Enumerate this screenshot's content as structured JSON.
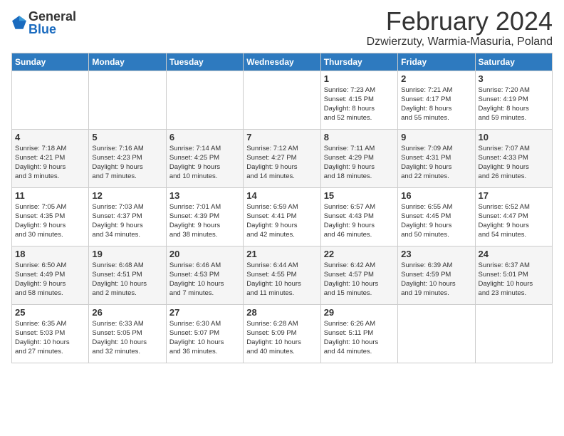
{
  "logo": {
    "general": "General",
    "blue": "Blue"
  },
  "title": "February 2024",
  "subtitle": "Dzwierzuty, Warmia-Masuria, Poland",
  "days_of_week": [
    "Sunday",
    "Monday",
    "Tuesday",
    "Wednesday",
    "Thursday",
    "Friday",
    "Saturday"
  ],
  "weeks": [
    [
      {
        "day": "",
        "info": ""
      },
      {
        "day": "",
        "info": ""
      },
      {
        "day": "",
        "info": ""
      },
      {
        "day": "",
        "info": ""
      },
      {
        "day": "1",
        "info": "Sunrise: 7:23 AM\nSunset: 4:15 PM\nDaylight: 8 hours\nand 52 minutes."
      },
      {
        "day": "2",
        "info": "Sunrise: 7:21 AM\nSunset: 4:17 PM\nDaylight: 8 hours\nand 55 minutes."
      },
      {
        "day": "3",
        "info": "Sunrise: 7:20 AM\nSunset: 4:19 PM\nDaylight: 8 hours\nand 59 minutes."
      }
    ],
    [
      {
        "day": "4",
        "info": "Sunrise: 7:18 AM\nSunset: 4:21 PM\nDaylight: 9 hours\nand 3 minutes."
      },
      {
        "day": "5",
        "info": "Sunrise: 7:16 AM\nSunset: 4:23 PM\nDaylight: 9 hours\nand 7 minutes."
      },
      {
        "day": "6",
        "info": "Sunrise: 7:14 AM\nSunset: 4:25 PM\nDaylight: 9 hours\nand 10 minutes."
      },
      {
        "day": "7",
        "info": "Sunrise: 7:12 AM\nSunset: 4:27 PM\nDaylight: 9 hours\nand 14 minutes."
      },
      {
        "day": "8",
        "info": "Sunrise: 7:11 AM\nSunset: 4:29 PM\nDaylight: 9 hours\nand 18 minutes."
      },
      {
        "day": "9",
        "info": "Sunrise: 7:09 AM\nSunset: 4:31 PM\nDaylight: 9 hours\nand 22 minutes."
      },
      {
        "day": "10",
        "info": "Sunrise: 7:07 AM\nSunset: 4:33 PM\nDaylight: 9 hours\nand 26 minutes."
      }
    ],
    [
      {
        "day": "11",
        "info": "Sunrise: 7:05 AM\nSunset: 4:35 PM\nDaylight: 9 hours\nand 30 minutes."
      },
      {
        "day": "12",
        "info": "Sunrise: 7:03 AM\nSunset: 4:37 PM\nDaylight: 9 hours\nand 34 minutes."
      },
      {
        "day": "13",
        "info": "Sunrise: 7:01 AM\nSunset: 4:39 PM\nDaylight: 9 hours\nand 38 minutes."
      },
      {
        "day": "14",
        "info": "Sunrise: 6:59 AM\nSunset: 4:41 PM\nDaylight: 9 hours\nand 42 minutes."
      },
      {
        "day": "15",
        "info": "Sunrise: 6:57 AM\nSunset: 4:43 PM\nDaylight: 9 hours\nand 46 minutes."
      },
      {
        "day": "16",
        "info": "Sunrise: 6:55 AM\nSunset: 4:45 PM\nDaylight: 9 hours\nand 50 minutes."
      },
      {
        "day": "17",
        "info": "Sunrise: 6:52 AM\nSunset: 4:47 PM\nDaylight: 9 hours\nand 54 minutes."
      }
    ],
    [
      {
        "day": "18",
        "info": "Sunrise: 6:50 AM\nSunset: 4:49 PM\nDaylight: 9 hours\nand 58 minutes."
      },
      {
        "day": "19",
        "info": "Sunrise: 6:48 AM\nSunset: 4:51 PM\nDaylight: 10 hours\nand 2 minutes."
      },
      {
        "day": "20",
        "info": "Sunrise: 6:46 AM\nSunset: 4:53 PM\nDaylight: 10 hours\nand 7 minutes."
      },
      {
        "day": "21",
        "info": "Sunrise: 6:44 AM\nSunset: 4:55 PM\nDaylight: 10 hours\nand 11 minutes."
      },
      {
        "day": "22",
        "info": "Sunrise: 6:42 AM\nSunset: 4:57 PM\nDaylight: 10 hours\nand 15 minutes."
      },
      {
        "day": "23",
        "info": "Sunrise: 6:39 AM\nSunset: 4:59 PM\nDaylight: 10 hours\nand 19 minutes."
      },
      {
        "day": "24",
        "info": "Sunrise: 6:37 AM\nSunset: 5:01 PM\nDaylight: 10 hours\nand 23 minutes."
      }
    ],
    [
      {
        "day": "25",
        "info": "Sunrise: 6:35 AM\nSunset: 5:03 PM\nDaylight: 10 hours\nand 27 minutes."
      },
      {
        "day": "26",
        "info": "Sunrise: 6:33 AM\nSunset: 5:05 PM\nDaylight: 10 hours\nand 32 minutes."
      },
      {
        "day": "27",
        "info": "Sunrise: 6:30 AM\nSunset: 5:07 PM\nDaylight: 10 hours\nand 36 minutes."
      },
      {
        "day": "28",
        "info": "Sunrise: 6:28 AM\nSunset: 5:09 PM\nDaylight: 10 hours\nand 40 minutes."
      },
      {
        "day": "29",
        "info": "Sunrise: 6:26 AM\nSunset: 5:11 PM\nDaylight: 10 hours\nand 44 minutes."
      },
      {
        "day": "",
        "info": ""
      },
      {
        "day": "",
        "info": ""
      }
    ]
  ]
}
